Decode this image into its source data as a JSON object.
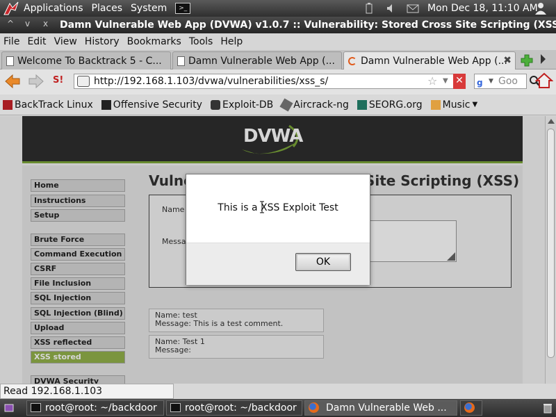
{
  "top_panel": {
    "menus": [
      "Applications",
      "Places",
      "System"
    ],
    "clock": "Mon Dec 18, 11:10 AM"
  },
  "window": {
    "title": "Damn Vulnerable Web App (DVWA) v1.0.7 :: Vulnerability: Stored Cross Site Scripting (XSS) -",
    "controls": [
      "^",
      "v",
      "x"
    ]
  },
  "menubar": [
    "File",
    "Edit",
    "View",
    "History",
    "Bookmarks",
    "Tools",
    "Help"
  ],
  "tabs": [
    {
      "label": "Welcome To Backtrack 5 - C..."
    },
    {
      "label": "Damn Vulnerable Web App (..."
    },
    {
      "label": "Damn Vulnerable Web App (..."
    }
  ],
  "navbar": {
    "url": "http://192.168.1.103/dvwa/vulnerabilities/xss_s/",
    "search_placeholder": "Goo",
    "stumble_label": "S!"
  },
  "bookmarks": [
    "BackTrack Linux",
    "Offensive Security",
    "Exploit-DB",
    "Aircrack-ng",
    "SEORG.org",
    "Music"
  ],
  "dvwa": {
    "logo": "DVWA",
    "page_title": "Vulnerability: Stored Cross Site Scripting (XSS)",
    "form": {
      "name_label": "Name *",
      "message_label": "Message *"
    },
    "nav_group1": [
      "Home",
      "Instructions",
      "Setup"
    ],
    "nav_group2": [
      "Brute Force",
      "Command Execution",
      "CSRF",
      "File Inclusion",
      "SQL Injection",
      "SQL Injection (Blind)",
      "Upload",
      "XSS reflected",
      "XSS stored"
    ],
    "nav_group3": [
      "DVWA Security"
    ],
    "comments": [
      {
        "name": "Name: test",
        "message": "Message: This is a test comment."
      },
      {
        "name": "Name: Test 1",
        "message": "Message:"
      }
    ]
  },
  "dialog": {
    "message": "This is a XSS Exploit Test",
    "ok_label": "OK"
  },
  "statusbar": {
    "text": "Read 192.168.1.103"
  },
  "taskbar": [
    {
      "label": "root@root: ~/backdoor"
    },
    {
      "label": "root@root: ~/backdoor"
    },
    {
      "label": "Damn Vulnerable Web ..."
    }
  ],
  "colors": {
    "dvwa_green": "#93b24a",
    "header_dark": "#2e2e2e",
    "close_red": "#e04040"
  }
}
